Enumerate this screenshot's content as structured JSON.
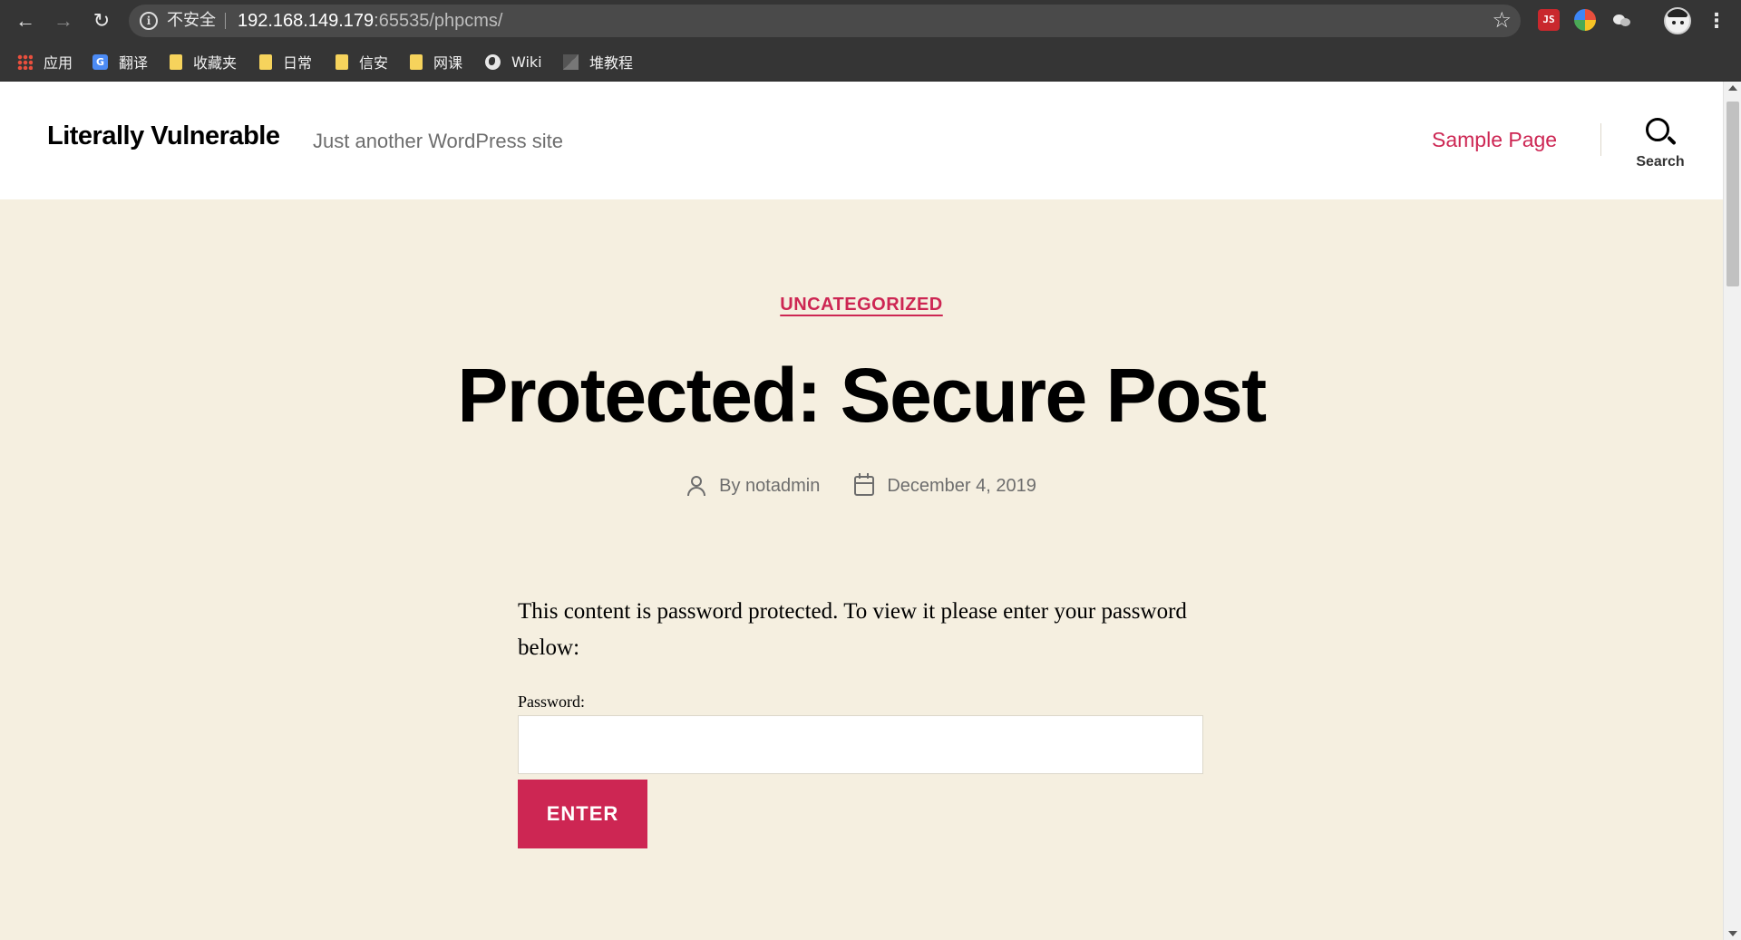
{
  "browser": {
    "back_icon": "←",
    "forward_icon": "→",
    "reload_icon": "↻",
    "info_icon": "i",
    "insecure_label": "不安全",
    "url_host": "192.168.149.179",
    "url_rest": ":65535/phpcms/",
    "star_icon": "☆",
    "ext_js_label": "JS",
    "menu_icon": "⋮"
  },
  "bookmarks": {
    "items": [
      {
        "label": "应用",
        "icon": "apps-icon"
      },
      {
        "label": "翻译",
        "icon": "translate-icon",
        "badge": "G"
      },
      {
        "label": "收藏夹",
        "icon": "folder-icon"
      },
      {
        "label": "日常",
        "icon": "folder-icon"
      },
      {
        "label": "信安",
        "icon": "folder-icon"
      },
      {
        "label": "网课",
        "icon": "folder-icon"
      },
      {
        "label": "Wiki",
        "icon": "globe-icon"
      },
      {
        "label": "堆教程",
        "icon": "tutorial-icon"
      }
    ]
  },
  "site": {
    "title": "Literally Vulnerable",
    "description": "Just another WordPress site",
    "nav_sample": "Sample Page",
    "search_label": "Search"
  },
  "post": {
    "category": "UNCATEGORIZED",
    "title": "Protected: Secure Post",
    "author": "By notadmin",
    "date": "December 4, 2019",
    "intro": "This content is password protected. To view it please enter your password below:",
    "password_label": "Password:",
    "password_value": "",
    "submit_label": "ENTER"
  },
  "colors": {
    "accent": "#cd2653",
    "background": "#f5efe0",
    "header_bg": "#ffffff",
    "chrome_bg": "#353535"
  }
}
